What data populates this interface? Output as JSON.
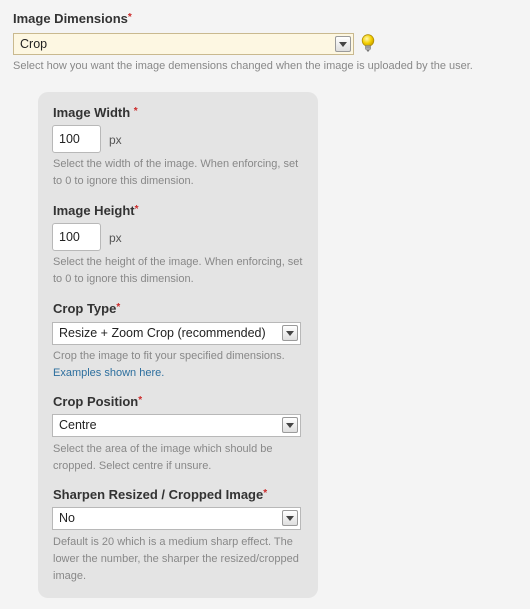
{
  "image_dimensions": {
    "label": "Image Dimensions",
    "required_mark": "*",
    "value": "Crop",
    "help": "Select how you want the image demensions changed when the image is uploaded by the user."
  },
  "image_width": {
    "label": "Image Width",
    "required_mark": "*",
    "value": "100",
    "unit": "px",
    "help": "Select the width of the image. When enforcing, set to 0 to ignore this dimension."
  },
  "image_height": {
    "label": "Image Height",
    "required_mark": "*",
    "value": "100",
    "unit": "px",
    "help": "Select the height of the image. When enforcing, set to 0 to ignore this dimension."
  },
  "crop_type": {
    "label": "Crop Type",
    "required_mark": "*",
    "value": "Resize + Zoom Crop (recommended)",
    "help": "Crop the image to fit your specified dimensions.",
    "link": "Examples shown here."
  },
  "crop_position": {
    "label": "Crop Position",
    "required_mark": "*",
    "value": "Centre",
    "help": "Select the area of the image which should be cropped. Select centre if unsure."
  },
  "sharpen": {
    "label": "Sharpen Resized / Cropped Image",
    "required_mark": "*",
    "value": "No",
    "help": "Default is 20 which is a medium sharp effect. The lower the number, the sharper the resized/cropped image."
  },
  "icons": {
    "hint": "lightbulb-icon",
    "dropdown": "chevron-down-icon"
  },
  "colors": {
    "required": "#cc2a2a",
    "link": "#2d6f9e",
    "highlight": "#fdf7e2",
    "panel": "#e4e4e4"
  }
}
